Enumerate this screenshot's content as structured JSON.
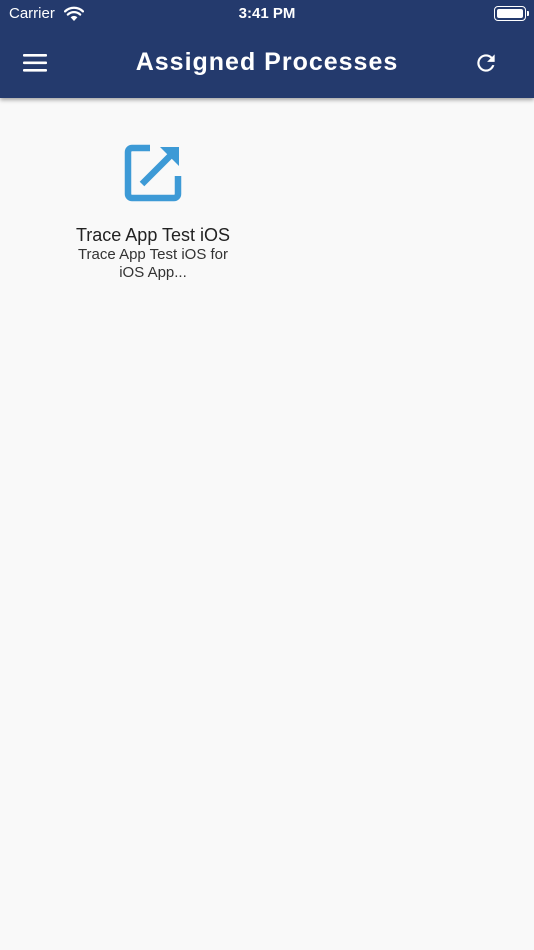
{
  "status_bar": {
    "carrier": "Carrier",
    "time": "3:41 PM",
    "wifi_icon": "wifi-icon",
    "battery_icon": "battery-icon"
  },
  "header": {
    "title": "Assigned Processes",
    "menu_icon": "hamburger-menu-icon",
    "refresh_icon": "refresh-icon",
    "background_color": "#243a6d"
  },
  "processes": [
    {
      "name": "Trace App Test iOS",
      "description": "Trace App Test iOS for iOS App...",
      "icon": "open-external-icon",
      "icon_color": "#3d9ad6"
    }
  ]
}
